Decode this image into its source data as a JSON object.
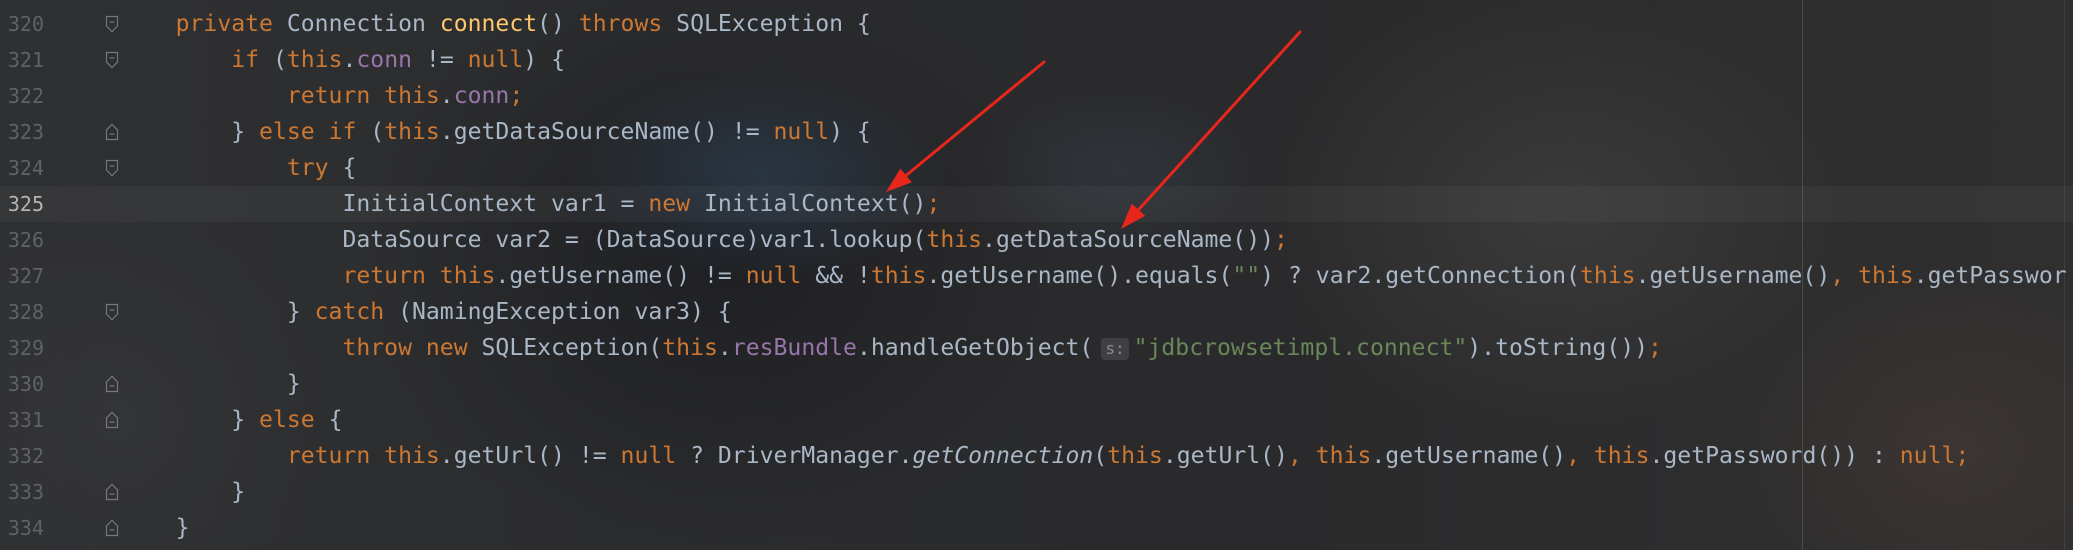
{
  "theme": {
    "default_text": "#A9B7C6",
    "line_number": "#5f6266",
    "current_line_number": "#b4b4b4",
    "annotation_arrow": "#e8261c"
  },
  "editor": {
    "current_line": 325,
    "lines": [
      {
        "number": "320",
        "fold_icon": "fold-start-icon",
        "tokens": [
          {
            "text": "    "
          },
          {
            "text": "private",
            "color": "#CC7832"
          },
          {
            "text": " Connection "
          },
          {
            "text": "connect",
            "color": "#FFC66D"
          },
          {
            "text": "() "
          },
          {
            "text": "throws",
            "color": "#CC7832"
          },
          {
            "text": " SQLException {"
          }
        ]
      },
      {
        "number": "321",
        "fold_icon": "fold-start-icon",
        "tokens": [
          {
            "text": "        "
          },
          {
            "text": "if",
            "color": "#CC7832"
          },
          {
            "text": " ("
          },
          {
            "text": "this",
            "color": "#CC7832"
          },
          {
            "text": "."
          },
          {
            "text": "conn",
            "color": "#9876AA"
          },
          {
            "text": " != "
          },
          {
            "text": "null",
            "color": "#CC7832"
          },
          {
            "text": ") {"
          }
        ]
      },
      {
        "number": "322",
        "fold_icon": null,
        "tokens": [
          {
            "text": "            "
          },
          {
            "text": "return",
            "color": "#CC7832"
          },
          {
            "text": " "
          },
          {
            "text": "this",
            "color": "#CC7832"
          },
          {
            "text": "."
          },
          {
            "text": "conn",
            "color": "#9876AA"
          },
          {
            "text": ";",
            "color": "#CC7832"
          }
        ]
      },
      {
        "number": "323",
        "fold_icon": "fold-end-icon",
        "tokens": [
          {
            "text": "        "
          },
          {
            "text": "} "
          },
          {
            "text": "else if",
            "color": "#CC7832"
          },
          {
            "text": " ("
          },
          {
            "text": "this",
            "color": "#CC7832"
          },
          {
            "text": ".getDataSourceName() != "
          },
          {
            "text": "null",
            "color": "#CC7832"
          },
          {
            "text": ") {"
          }
        ]
      },
      {
        "number": "324",
        "fold_icon": "fold-start-icon",
        "tokens": [
          {
            "text": "            "
          },
          {
            "text": "try",
            "color": "#CC7832"
          },
          {
            "text": " {"
          }
        ]
      },
      {
        "number": "325",
        "fold_icon": null,
        "tokens": [
          {
            "text": "                "
          },
          {
            "text": "InitialContext var1 = "
          },
          {
            "text": "new",
            "color": "#CC7832"
          },
          {
            "text": " InitialContext()"
          },
          {
            "text": ";",
            "color": "#CC7832"
          }
        ]
      },
      {
        "number": "326",
        "fold_icon": null,
        "tokens": [
          {
            "text": "                "
          },
          {
            "text": "DataSource var2 = (DataSource)var1.lookup("
          },
          {
            "text": "this",
            "color": "#CC7832"
          },
          {
            "text": ".getDataSourceName())"
          },
          {
            "text": ";",
            "color": "#CC7832"
          }
        ]
      },
      {
        "number": "327",
        "fold_icon": null,
        "tokens": [
          {
            "text": "                "
          },
          {
            "text": "return",
            "color": "#CC7832"
          },
          {
            "text": " "
          },
          {
            "text": "this",
            "color": "#CC7832"
          },
          {
            "text": ".getUsername() != "
          },
          {
            "text": "null",
            "color": "#CC7832"
          },
          {
            "text": " && !"
          },
          {
            "text": "this",
            "color": "#CC7832"
          },
          {
            "text": ".getUsername().equals("
          },
          {
            "text": "\"\"",
            "color": "#6A8759"
          },
          {
            "text": ") ? var2.getConnection("
          },
          {
            "text": "this",
            "color": "#CC7832"
          },
          {
            "text": ".getUsername()"
          },
          {
            "text": ",",
            "color": "#CC7832"
          },
          {
            "text": " "
          },
          {
            "text": "this",
            "color": "#CC7832"
          },
          {
            "text": ".getPasswor"
          }
        ]
      },
      {
        "number": "328",
        "fold_icon": "fold-start-icon",
        "tokens": [
          {
            "text": "            "
          },
          {
            "text": "} "
          },
          {
            "text": "catch",
            "color": "#CC7832"
          },
          {
            "text": " (NamingException var3) {"
          }
        ]
      },
      {
        "number": "329",
        "fold_icon": null,
        "tokens": [
          {
            "text": "                "
          },
          {
            "text": "throw",
            "color": "#CC7832"
          },
          {
            "text": " "
          },
          {
            "text": "new",
            "color": "#CC7832"
          },
          {
            "text": " SQLException("
          },
          {
            "text": "this",
            "color": "#CC7832"
          },
          {
            "text": "."
          },
          {
            "text": "resBundle",
            "color": "#9876AA"
          },
          {
            "text": ".handleGetObject("
          },
          {
            "text": "s:",
            "hint": true
          },
          {
            "text": "\"jdbcrowsetimpl.connect\"",
            "color": "#6A8759"
          },
          {
            "text": ").toString())"
          },
          {
            "text": ";",
            "color": "#CC7832"
          }
        ]
      },
      {
        "number": "330",
        "fold_icon": "fold-end-icon",
        "tokens": [
          {
            "text": "            "
          },
          {
            "text": "}"
          }
        ]
      },
      {
        "number": "331",
        "fold_icon": "fold-end-icon",
        "tokens": [
          {
            "text": "        "
          },
          {
            "text": "} "
          },
          {
            "text": "else",
            "color": "#CC7832"
          },
          {
            "text": " {"
          }
        ]
      },
      {
        "number": "332",
        "fold_icon": null,
        "tokens": [
          {
            "text": "            "
          },
          {
            "text": "return",
            "color": "#CC7832"
          },
          {
            "text": " "
          },
          {
            "text": "this",
            "color": "#CC7832"
          },
          {
            "text": ".getUrl() != "
          },
          {
            "text": "null",
            "color": "#CC7832"
          },
          {
            "text": " ? DriverManager."
          },
          {
            "text": "getConnection",
            "italic": true
          },
          {
            "text": "("
          },
          {
            "text": "this",
            "color": "#CC7832"
          },
          {
            "text": ".getUrl()"
          },
          {
            "text": ",",
            "color": "#CC7832"
          },
          {
            "text": " "
          },
          {
            "text": "this",
            "color": "#CC7832"
          },
          {
            "text": ".getUsername()"
          },
          {
            "text": ",",
            "color": "#CC7832"
          },
          {
            "text": " "
          },
          {
            "text": "this",
            "color": "#CC7832"
          },
          {
            "text": ".getPassword()) : "
          },
          {
            "text": "null",
            "color": "#CC7832"
          },
          {
            "text": ";",
            "color": "#CC7832"
          }
        ]
      },
      {
        "number": "333",
        "fold_icon": "fold-end-icon",
        "tokens": [
          {
            "text": "        "
          },
          {
            "text": "}"
          }
        ]
      },
      {
        "number": "334",
        "fold_icon": "fold-end-icon",
        "tokens": [
          {
            "text": "    "
          },
          {
            "text": "}"
          }
        ]
      }
    ]
  }
}
